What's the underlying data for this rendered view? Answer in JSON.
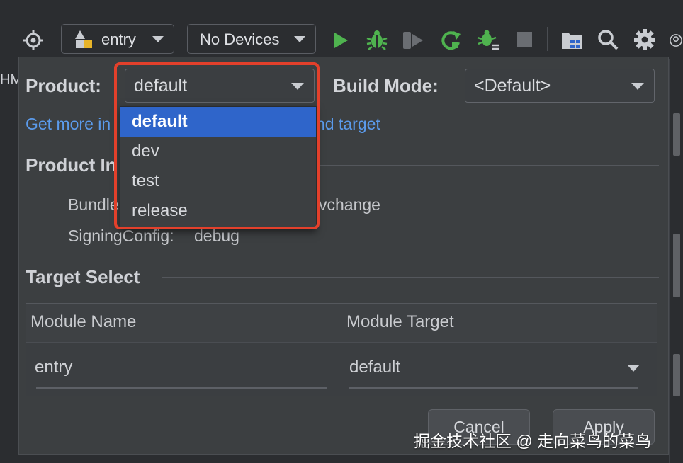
{
  "toolbar": {
    "module_combo": {
      "label": "entry",
      "icon": "module-icon"
    },
    "device_combo": {
      "label": "No Devices"
    },
    "colors": {
      "run": "#4fb34f",
      "bug": "#4fb34f",
      "stop": "#6a6d72"
    }
  },
  "side": {
    "left_label": "HM"
  },
  "dialog": {
    "product_label": "Product:",
    "product_value": "default",
    "build_mode_label": "Build Mode:",
    "build_mode_value": "<Default>",
    "link_left": "Get more in",
    "link_right": "nd target",
    "product_info_title": "Product In",
    "bundle_label": "Bundle",
    "bundle_value": "vchange",
    "signing_label": "SigningConfig:",
    "signing_value": "debug",
    "target_select_title": "Target Select",
    "table": {
      "headers": [
        "Module Name",
        "Module Target"
      ],
      "rows": [
        {
          "module": "entry",
          "target": "default"
        }
      ]
    },
    "cancel_label": "Cancel",
    "apply_label": "Apply"
  },
  "dropdown": {
    "options": [
      "default",
      "dev",
      "test",
      "release"
    ],
    "selected": "default",
    "accent": "#2f65ca",
    "highlight_color": "#e3402b"
  },
  "watermark": "掘金技术社区 @ 走向菜鸟的菜鸟"
}
